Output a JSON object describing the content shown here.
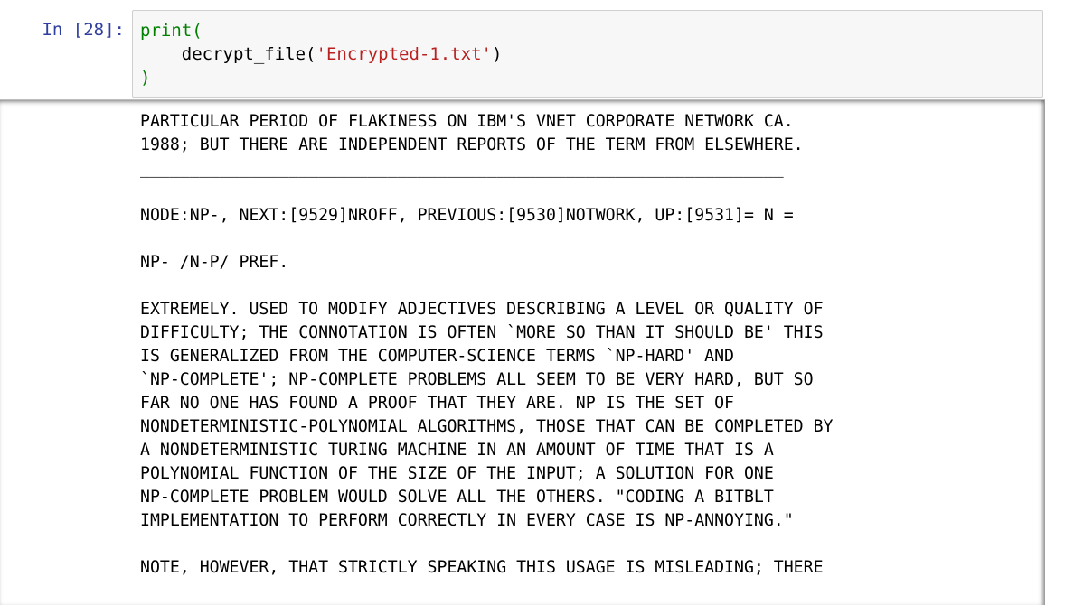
{
  "prompt": "In [28]:",
  "code": {
    "line1_func": "print",
    "line1_paren": "(",
    "line2_func": "decrypt_file",
    "line2_open": "(",
    "line2_arg": "'Encrypted-1.txt'",
    "line2_close": ")",
    "line3": ")"
  },
  "output_lines": [
    "PARTICULAR PERIOD OF FLAKINESS ON IBM'S VNET CORPORATE NETWORK CA.",
    "1988; BUT THERE ARE INDEPENDENT REPORTS OF THE TERM FROM ELSEWHERE.",
    "_________________________________________________________________",
    "",
    "NODE:NP-, NEXT:[9529]NROFF, PREVIOUS:[9530]NOTWORK, UP:[9531]= N =",
    "",
    "NP- /N-P/ PREF.",
    "",
    "EXTREMELY. USED TO MODIFY ADJECTIVES DESCRIBING A LEVEL OR QUALITY OF",
    "DIFFICULTY; THE CONNOTATION IS OFTEN `MORE SO THAN IT SHOULD BE' THIS",
    "IS GENERALIZED FROM THE COMPUTER-SCIENCE TERMS `NP-HARD' AND",
    "`NP-COMPLETE'; NP-COMPLETE PROBLEMS ALL SEEM TO BE VERY HARD, BUT SO",
    "FAR NO ONE HAS FOUND A PROOF THAT THEY ARE. NP IS THE SET OF",
    "NONDETERMINISTIC-POLYNOMIAL ALGORITHMS, THOSE THAT CAN BE COMPLETED BY",
    "A NONDETERMINISTIC TURING MACHINE IN AN AMOUNT OF TIME THAT IS A",
    "POLYNOMIAL FUNCTION OF THE SIZE OF THE INPUT; A SOLUTION FOR ONE",
    "NP-COMPLETE PROBLEM WOULD SOLVE ALL THE OTHERS. \"CODING A BITBLT",
    "IMPLEMENTATION TO PERFORM CORRECTLY IN EVERY CASE IS NP-ANNOYING.\"",
    "",
    "NOTE, HOWEVER, THAT STRICTLY SPEAKING THIS USAGE IS MISLEADING; THERE"
  ]
}
